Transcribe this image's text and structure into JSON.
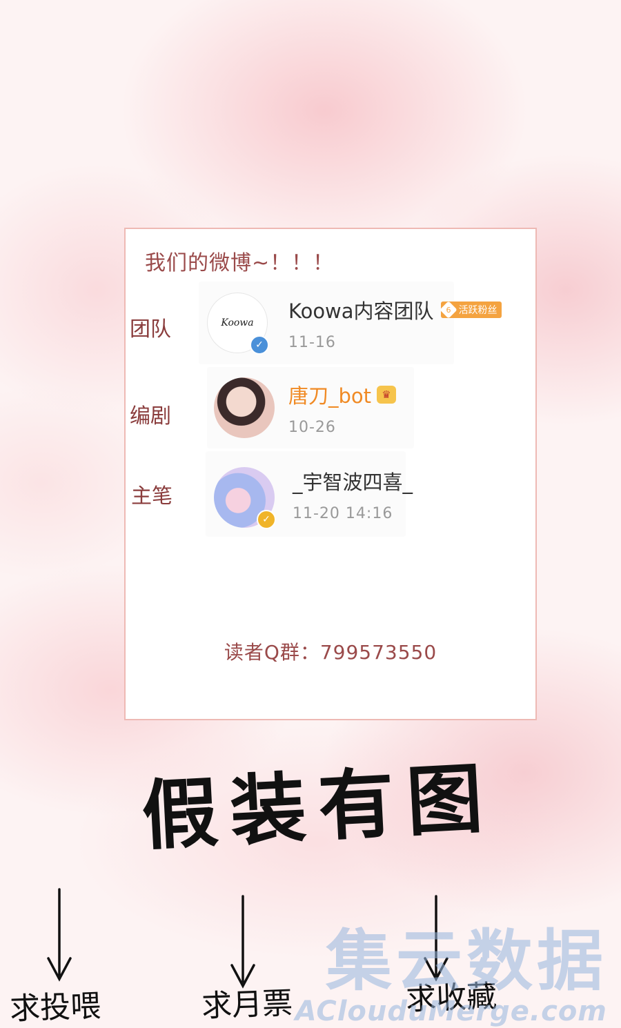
{
  "card": {
    "title": "我们的微博~！！！",
    "accounts": [
      {
        "role": "团队",
        "name": "Koowa内容团队",
        "badge": "活跃粉丝",
        "badge_level": "6",
        "date": "11-16",
        "avatar_text": "Koowa",
        "verify_color": "#4a90d9"
      },
      {
        "role": "编剧",
        "name": "唐刀_bot",
        "date": "10-26",
        "name_color": "#f08a24"
      },
      {
        "role": "主笔",
        "name": "_宇智波四喜_",
        "date": "11-20 14:16",
        "verify_color": "#f0b429"
      }
    ],
    "qq_group": "读者Q群：799573550"
  },
  "handwriting": {
    "main": "假装有图",
    "labels": [
      "求投喂",
      "求月票",
      "求收藏"
    ]
  },
  "watermark": {
    "cn": "集云数据",
    "en": "AClouduMerge.com"
  },
  "colors": {
    "accent": "#9a4a4a",
    "card_border": "#eeb9b4",
    "fan_badge": "#f4a340"
  }
}
